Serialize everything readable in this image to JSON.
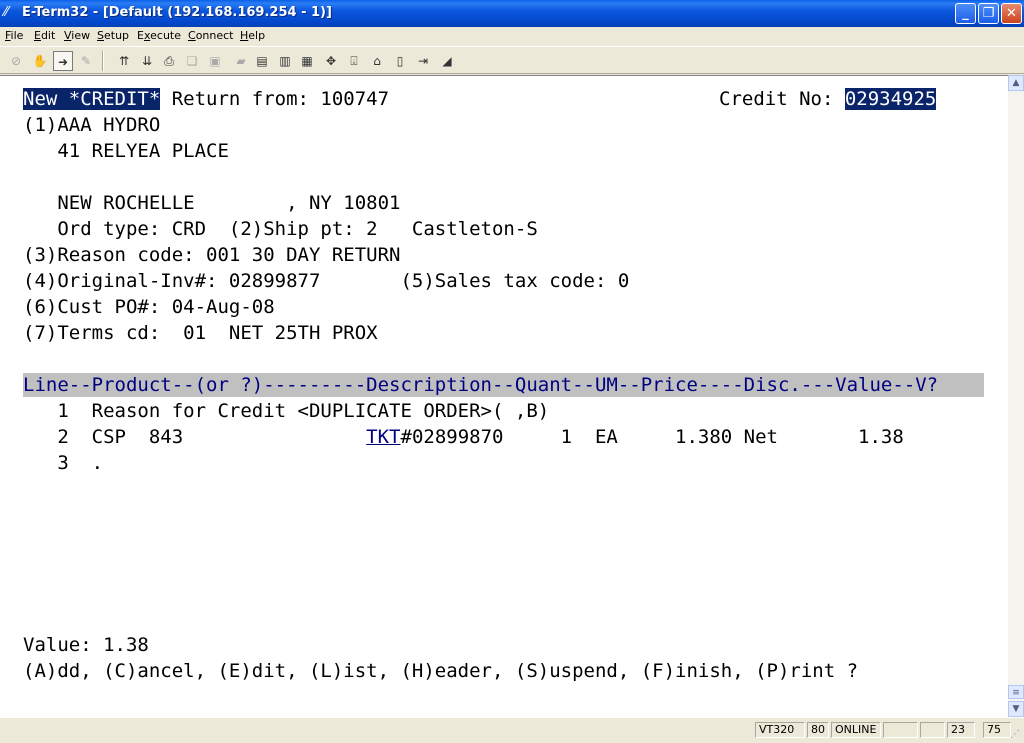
{
  "window": {
    "title": "E-Term32 - [Default (192.168.169.254 - 1)]",
    "buttons": {
      "minimize": "_",
      "restore": "❐",
      "close": "✕"
    }
  },
  "menu": [
    {
      "label": "File",
      "ul": "F",
      "rest": "ile"
    },
    {
      "label": "Edit",
      "ul": "E",
      "rest": "dit"
    },
    {
      "label": "View",
      "ul": "V",
      "rest": "iew"
    },
    {
      "label": "Setup",
      "ul": "S",
      "rest": "etup"
    },
    {
      "label": "Execute",
      "ul": "x",
      "pre": "E",
      "rest": "ecute"
    },
    {
      "label": "Connect",
      "ul": "C",
      "rest": "onnect"
    },
    {
      "label": "Help",
      "ul": "H",
      "rest": "elp"
    }
  ],
  "terminal": {
    "title_highlight": "New *CREDIT*",
    "title_rest": " Return from: 100747",
    "credit_label": "Credit No: ",
    "credit_no": "02934925",
    "line_name": "(1)AAA HYDRO",
    "line_addr1": "   41 RELYEA PLACE",
    "line_city": "   NEW ROCHELLE        , NY 10801",
    "line_ordtype": "   Ord type: CRD  (2)Ship pt: 2   Castleton-S",
    "line_reason": "(3)Reason code: 001 30 DAY RETURN",
    "line_originv": "(4)Original-Inv#: 02899877       (5)Sales tax code: 0",
    "line_custpo": "(6)Cust PO#: 04-Aug-08",
    "line_terms": "(7)Terms cd:  01  NET 25TH PROX",
    "table_header": "Line--Product--(or ?)---------Description--Quant--UM--Price----Disc.---Value--V?",
    "row1": "   1  Reason for Credit <DUPLICATE ORDER>( ,B)",
    "row2_pre": "   2  CSP  843                ",
    "row2_link": "TKT",
    "row2_post": "#02899870     1  EA     1.380 Net       1.38",
    "row3": "   3  .",
    "value_line": "Value: 1.38",
    "prompt_line": "(A)dd, (C)ancel, (E)dit, (L)ist, (H)eader, (S)uspend, (F)inish, (P)rint ?"
  },
  "status": {
    "emulation": "VT320",
    "columns": "80",
    "connection": "ONLINE",
    "row": "23",
    "col": "75"
  }
}
